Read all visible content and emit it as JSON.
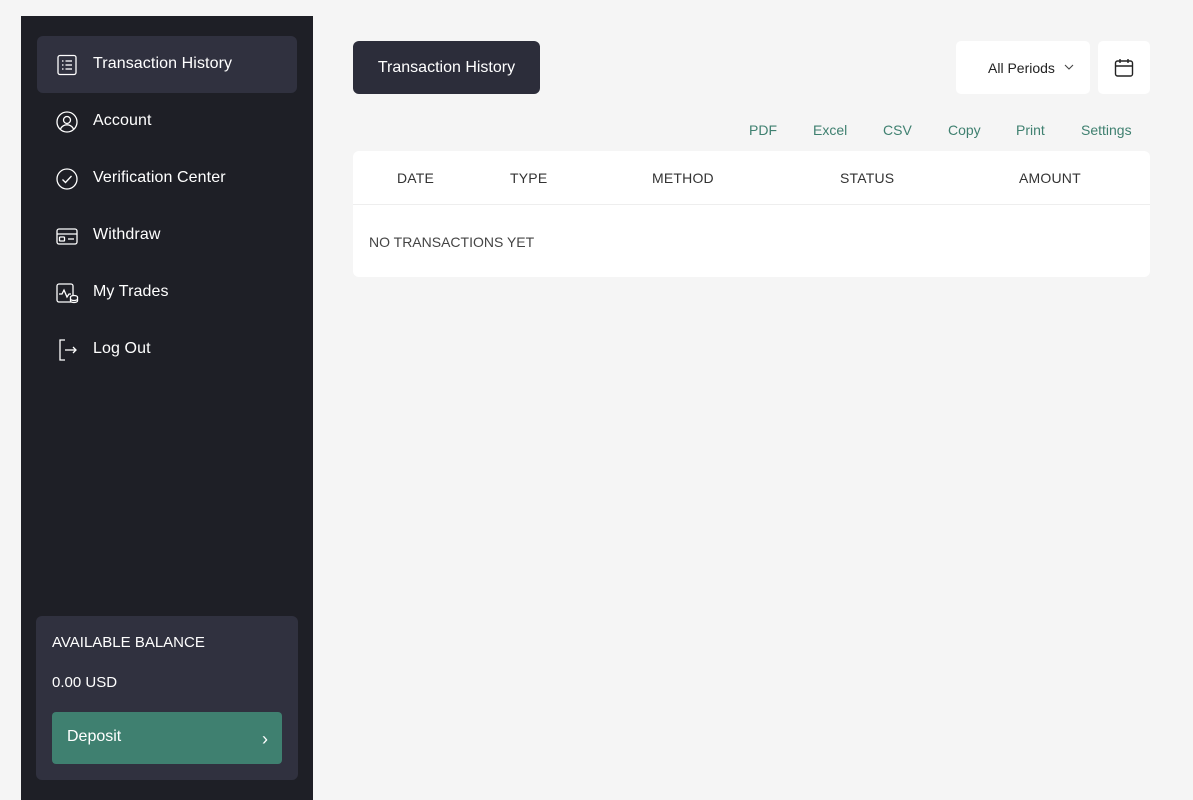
{
  "sidebar": {
    "items": [
      {
        "label": "Transaction History",
        "icon": "list-icon",
        "active": true
      },
      {
        "label": "Account",
        "icon": "user-circle-icon",
        "active": false
      },
      {
        "label": "Verification Center",
        "icon": "check-circle-icon",
        "active": false
      },
      {
        "label": "Withdraw",
        "icon": "wallet-icon",
        "active": false
      },
      {
        "label": "My Trades",
        "icon": "trades-icon",
        "active": false
      },
      {
        "label": "Log Out",
        "icon": "logout-icon",
        "active": false
      }
    ],
    "balance": {
      "title": "AVAILABLE BALANCE",
      "value": "0.00 USD",
      "deposit_label": "Deposit",
      "deposit_chevron": "›"
    }
  },
  "main": {
    "title": "Transaction History",
    "period_select": {
      "value": "All Periods"
    },
    "export_actions": [
      "PDF",
      "Excel",
      "CSV",
      "Copy",
      "Print",
      "Settings"
    ],
    "table": {
      "columns": [
        "DATE",
        "TYPE",
        "METHOD",
        "STATUS",
        "AMOUNT"
      ],
      "empty_message": "NO TRANSACTIONS YET"
    }
  },
  "colors": {
    "sidebar_bg": "#1e1f26",
    "active_item_bg": "#30313f",
    "accent": "#3f8070",
    "page_bg": "#f5f5f5"
  }
}
